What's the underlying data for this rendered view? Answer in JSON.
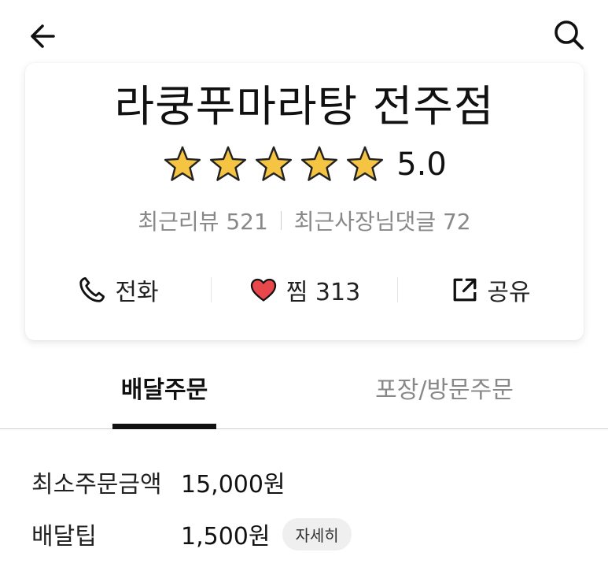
{
  "header": {
    "back_icon": "arrow-left-icon",
    "search_icon": "search-icon"
  },
  "store": {
    "name": "라쿵푸마라탕 전주점",
    "rating_stars": 5,
    "rating_score": "5.0",
    "recent_reviews": "최근리뷰 521",
    "owner_replies": "최근사장님댓글 72",
    "star_color": "#F6C443"
  },
  "actions": {
    "call_label": "전화",
    "like_label": "찜 313",
    "share_label": "공유",
    "heart_color": "#E8474B"
  },
  "tabs": {
    "delivery": "배달주문",
    "pickup": "포장/방문주문",
    "active": "delivery"
  },
  "info": {
    "min_order_label": "최소주문금액",
    "min_order_value": "15,000원",
    "delivery_tip_label": "배달팁",
    "delivery_tip_value": "1,500원",
    "detail_label": "자세히"
  }
}
